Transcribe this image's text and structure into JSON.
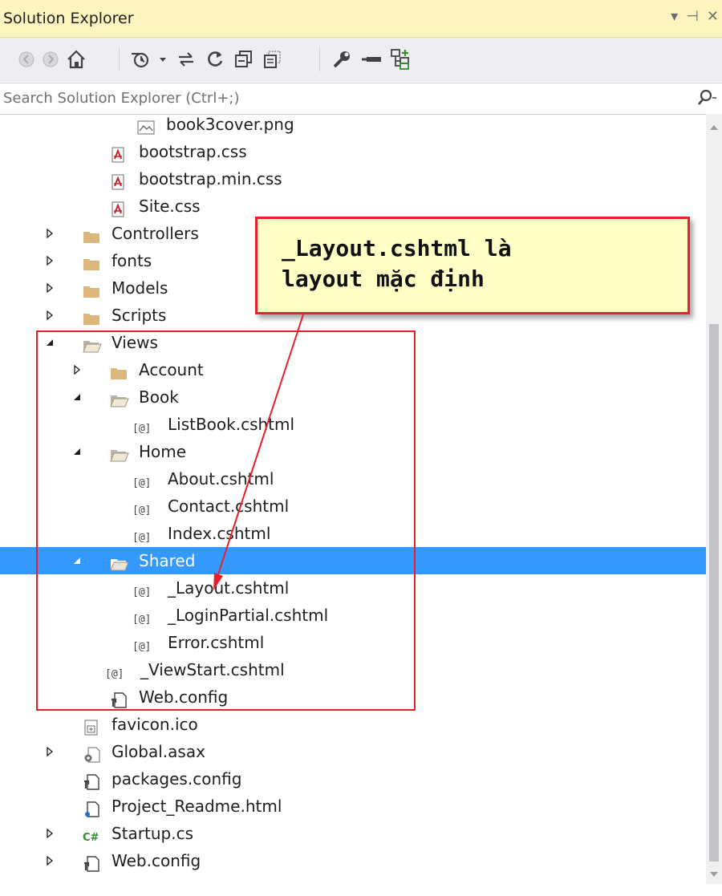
{
  "window": {
    "title": "Solution Explorer",
    "controls": {
      "dropdown": "▾",
      "pin": "⊣",
      "close": "✕"
    }
  },
  "toolbar": {
    "buttons": [
      "back-icon",
      "forward-icon",
      "home-icon",
      "pending-changes-icon",
      "dropdown-icon",
      "sync-icon",
      "refresh-icon",
      "collapse-all-icon",
      "show-all-files-icon",
      "properties-icon",
      "preview-icon",
      "class-view-icon"
    ]
  },
  "search": {
    "placeholder": "Search Solution Explorer (Ctrl+;)"
  },
  "tree": {
    "items": [
      {
        "label": "book3cover.png",
        "icon": "image-file-icon",
        "expander": "none"
      },
      {
        "label": "bootstrap.css",
        "icon": "css-file-icon",
        "expander": "none"
      },
      {
        "label": "bootstrap.min.css",
        "icon": "css-file-icon",
        "expander": "none"
      },
      {
        "label": "Site.css",
        "icon": "css-file-icon",
        "expander": "none"
      },
      {
        "label": "Controllers",
        "icon": "folder-icon",
        "expander": "collapsed"
      },
      {
        "label": "fonts",
        "icon": "folder-icon",
        "expander": "collapsed"
      },
      {
        "label": "Models",
        "icon": "folder-icon",
        "expander": "collapsed"
      },
      {
        "label": "Scripts",
        "icon": "folder-icon",
        "expander": "collapsed"
      },
      {
        "label": "Views",
        "icon": "folder-open-icon",
        "expander": "expanded"
      },
      {
        "label": "Account",
        "icon": "folder-icon",
        "expander": "collapsed"
      },
      {
        "label": "Book",
        "icon": "folder-open-icon",
        "expander": "expanded"
      },
      {
        "label": "ListBook.cshtml",
        "icon": "razor-file-icon",
        "expander": "none"
      },
      {
        "label": "Home",
        "icon": "folder-open-icon",
        "expander": "expanded"
      },
      {
        "label": "About.cshtml",
        "icon": "razor-file-icon",
        "expander": "none"
      },
      {
        "label": "Contact.cshtml",
        "icon": "razor-file-icon",
        "expander": "none"
      },
      {
        "label": "Index.cshtml",
        "icon": "razor-file-icon",
        "expander": "none"
      },
      {
        "label": "Shared",
        "icon": "folder-open-icon",
        "expander": "expanded",
        "selected": true
      },
      {
        "label": "_Layout.cshtml",
        "icon": "razor-file-icon",
        "expander": "none"
      },
      {
        "label": "_LoginPartial.cshtml",
        "icon": "razor-file-icon",
        "expander": "none"
      },
      {
        "label": "Error.cshtml",
        "icon": "razor-file-icon",
        "expander": "none"
      },
      {
        "label": "_ViewStart.cshtml",
        "icon": "razor-file-icon",
        "expander": "none"
      },
      {
        "label": "Web.config",
        "icon": "config-file-icon",
        "expander": "none"
      },
      {
        "label": "favicon.ico",
        "icon": "ico-file-icon",
        "expander": "none"
      },
      {
        "label": "Global.asax",
        "icon": "asax-file-icon",
        "expander": "collapsed"
      },
      {
        "label": "packages.config",
        "icon": "config-file-icon",
        "expander": "none"
      },
      {
        "label": "Project_Readme.html",
        "icon": "html-file-icon",
        "expander": "none"
      },
      {
        "label": "Startup.cs",
        "icon": "csharp-file-icon",
        "expander": "collapsed"
      },
      {
        "label": "Web.config",
        "icon": "config-file-icon",
        "expander": "collapsed"
      }
    ]
  },
  "razor_icon_text": "[@]",
  "csharp_icon_text": "C#",
  "annotation": {
    "line1": "_Layout.cshtml là",
    "line2": "layout mặc định"
  },
  "colors": {
    "title_bg": "#fdf4bf",
    "selection": "#3399ff",
    "highlight_red": "#e81d2e",
    "callout_bg": "#ffffc6",
    "folder": "#dcb67a"
  }
}
